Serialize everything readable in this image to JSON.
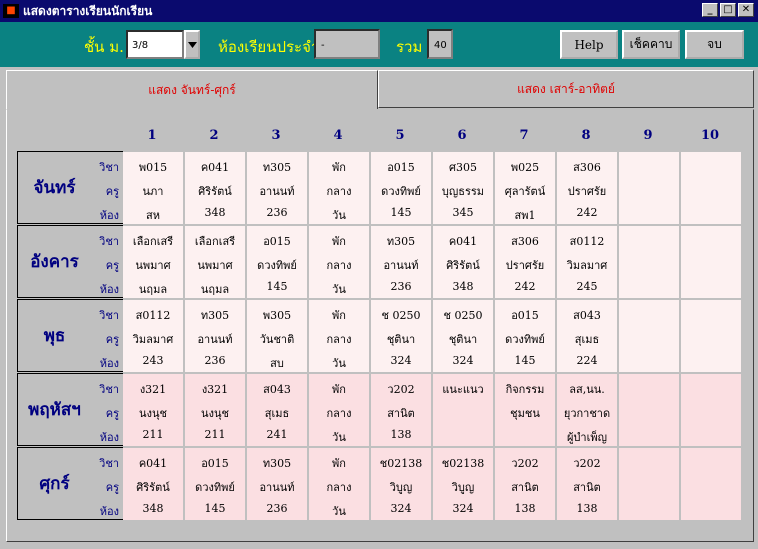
{
  "window": {
    "title": "แสดงตารางเรียนนักเรียน",
    "app_icon": "app-icon"
  },
  "toolbar": {
    "grade_label": "ชั้น ม.",
    "grade_value": "3/8",
    "homeroom_label": "ห้องเรียนประจำ",
    "homeroom_value": "-",
    "total_label": "รวม",
    "total_value": "40",
    "help_label": "Help",
    "check_label": "เช็คคาบ",
    "exit_label": "จบ"
  },
  "tabs": [
    {
      "label": "แสดง จันทร์-ศุกร์",
      "active": true
    },
    {
      "label": "แสดง เสาร์-อาทิตย์",
      "active": false
    }
  ],
  "columns": [
    "1",
    "2",
    "3",
    "4",
    "5",
    "6",
    "7",
    "8",
    "9",
    "10"
  ],
  "row_labels": [
    "วิชา",
    "ครู",
    "ห้อง"
  ],
  "colors": {
    "light_cell": "#fdf1f1",
    "pink_cell": "#fbdfe2",
    "title_bg": "#0a0a6e",
    "toolbar_bg": "#0a8282",
    "accent_yellow": "#ffff00",
    "tab_text": "#e00000",
    "day_text": "#000080"
  },
  "days": [
    {
      "name": "จันทร์",
      "shade": "light",
      "cells": [
        [
          "พ015",
          "นภา",
          "สห"
        ],
        [
          "ค041",
          "ศิริรัตน์",
          "348"
        ],
        [
          "ท305",
          "อานนท์",
          "236"
        ],
        [
          "พัก",
          "กลาง",
          "วัน"
        ],
        [
          "อ015",
          "ดวงทิพย์",
          "145"
        ],
        [
          "ศ305",
          "บุญธรรม",
          "345"
        ],
        [
          "พ025",
          "ศุลารัตน์",
          "สพ1"
        ],
        [
          "ส306",
          "ปราศรัย",
          "242"
        ],
        [
          "",
          "",
          ""
        ],
        [
          "",
          "",
          ""
        ]
      ]
    },
    {
      "name": "อังคาร",
      "shade": "light",
      "cells": [
        [
          "เลือกเสรี",
          "นพมาศ",
          "นฤมล"
        ],
        [
          "เลือกเสรี",
          "นพมาศ",
          "นฤมล"
        ],
        [
          "อ015",
          "ดวงทิพย์",
          "145"
        ],
        [
          "พัก",
          "กลาง",
          "วัน"
        ],
        [
          "ท305",
          "อานนท์",
          "236"
        ],
        [
          "ค041",
          "ศิริรัตน์",
          "348"
        ],
        [
          "ส306",
          "ปราศรัย",
          "242"
        ],
        [
          "ส0112",
          "วิมลมาศ",
          "245"
        ],
        [
          "",
          "",
          ""
        ],
        [
          "",
          "",
          ""
        ]
      ]
    },
    {
      "name": "พุธ",
      "shade": "light",
      "cells": [
        [
          "ส0112",
          "วิมลมาศ",
          "243"
        ],
        [
          "ท305",
          "อานนท์",
          "236"
        ],
        [
          "พ305",
          "วันชาติ",
          "สบ"
        ],
        [
          "พัก",
          "กลาง",
          "วัน"
        ],
        [
          "ช 0250",
          "ชุตินา",
          "324"
        ],
        [
          "ช 0250",
          "ชุตินา",
          "324"
        ],
        [
          "อ015",
          "ดวงทิพย์",
          "145"
        ],
        [
          "ส043",
          "สุเมธ",
          "224"
        ],
        [
          "",
          "",
          ""
        ],
        [
          "",
          "",
          ""
        ]
      ]
    },
    {
      "name": "พฤหัสฯ",
      "shade": "pink",
      "cells": [
        [
          "ง321",
          "นงนุช",
          "211"
        ],
        [
          "ง321",
          "นงนุช",
          "211"
        ],
        [
          "ส043",
          "สุเมธ",
          "241"
        ],
        [
          "พัก",
          "กลาง",
          "วัน"
        ],
        [
          "ว202",
          "สานิต",
          "138"
        ],
        [
          "แนะแนว",
          "",
          ""
        ],
        [
          "กิจกรรม",
          "ชุมชน",
          ""
        ],
        [
          "ลส,นน.",
          "ยุวกาชาด",
          "ผู้บำเพ็ญ"
        ],
        [
          "",
          "",
          ""
        ],
        [
          "",
          "",
          ""
        ]
      ]
    },
    {
      "name": "ศุกร์",
      "shade": "pink",
      "cells": [
        [
          "ค041",
          "ศิริรัตน์",
          "348"
        ],
        [
          "อ015",
          "ดวงทิพย์",
          "145"
        ],
        [
          "ท305",
          "อานนท์",
          "236"
        ],
        [
          "พัก",
          "กลาง",
          "วัน"
        ],
        [
          "ช02138",
          "วิบูญ",
          "324"
        ],
        [
          "ช02138",
          "วิบูญ",
          "324"
        ],
        [
          "ว202",
          "สานิต",
          "138"
        ],
        [
          "ว202",
          "สานิต",
          "138"
        ],
        [
          "",
          "",
          ""
        ],
        [
          "",
          "",
          ""
        ]
      ]
    }
  ]
}
